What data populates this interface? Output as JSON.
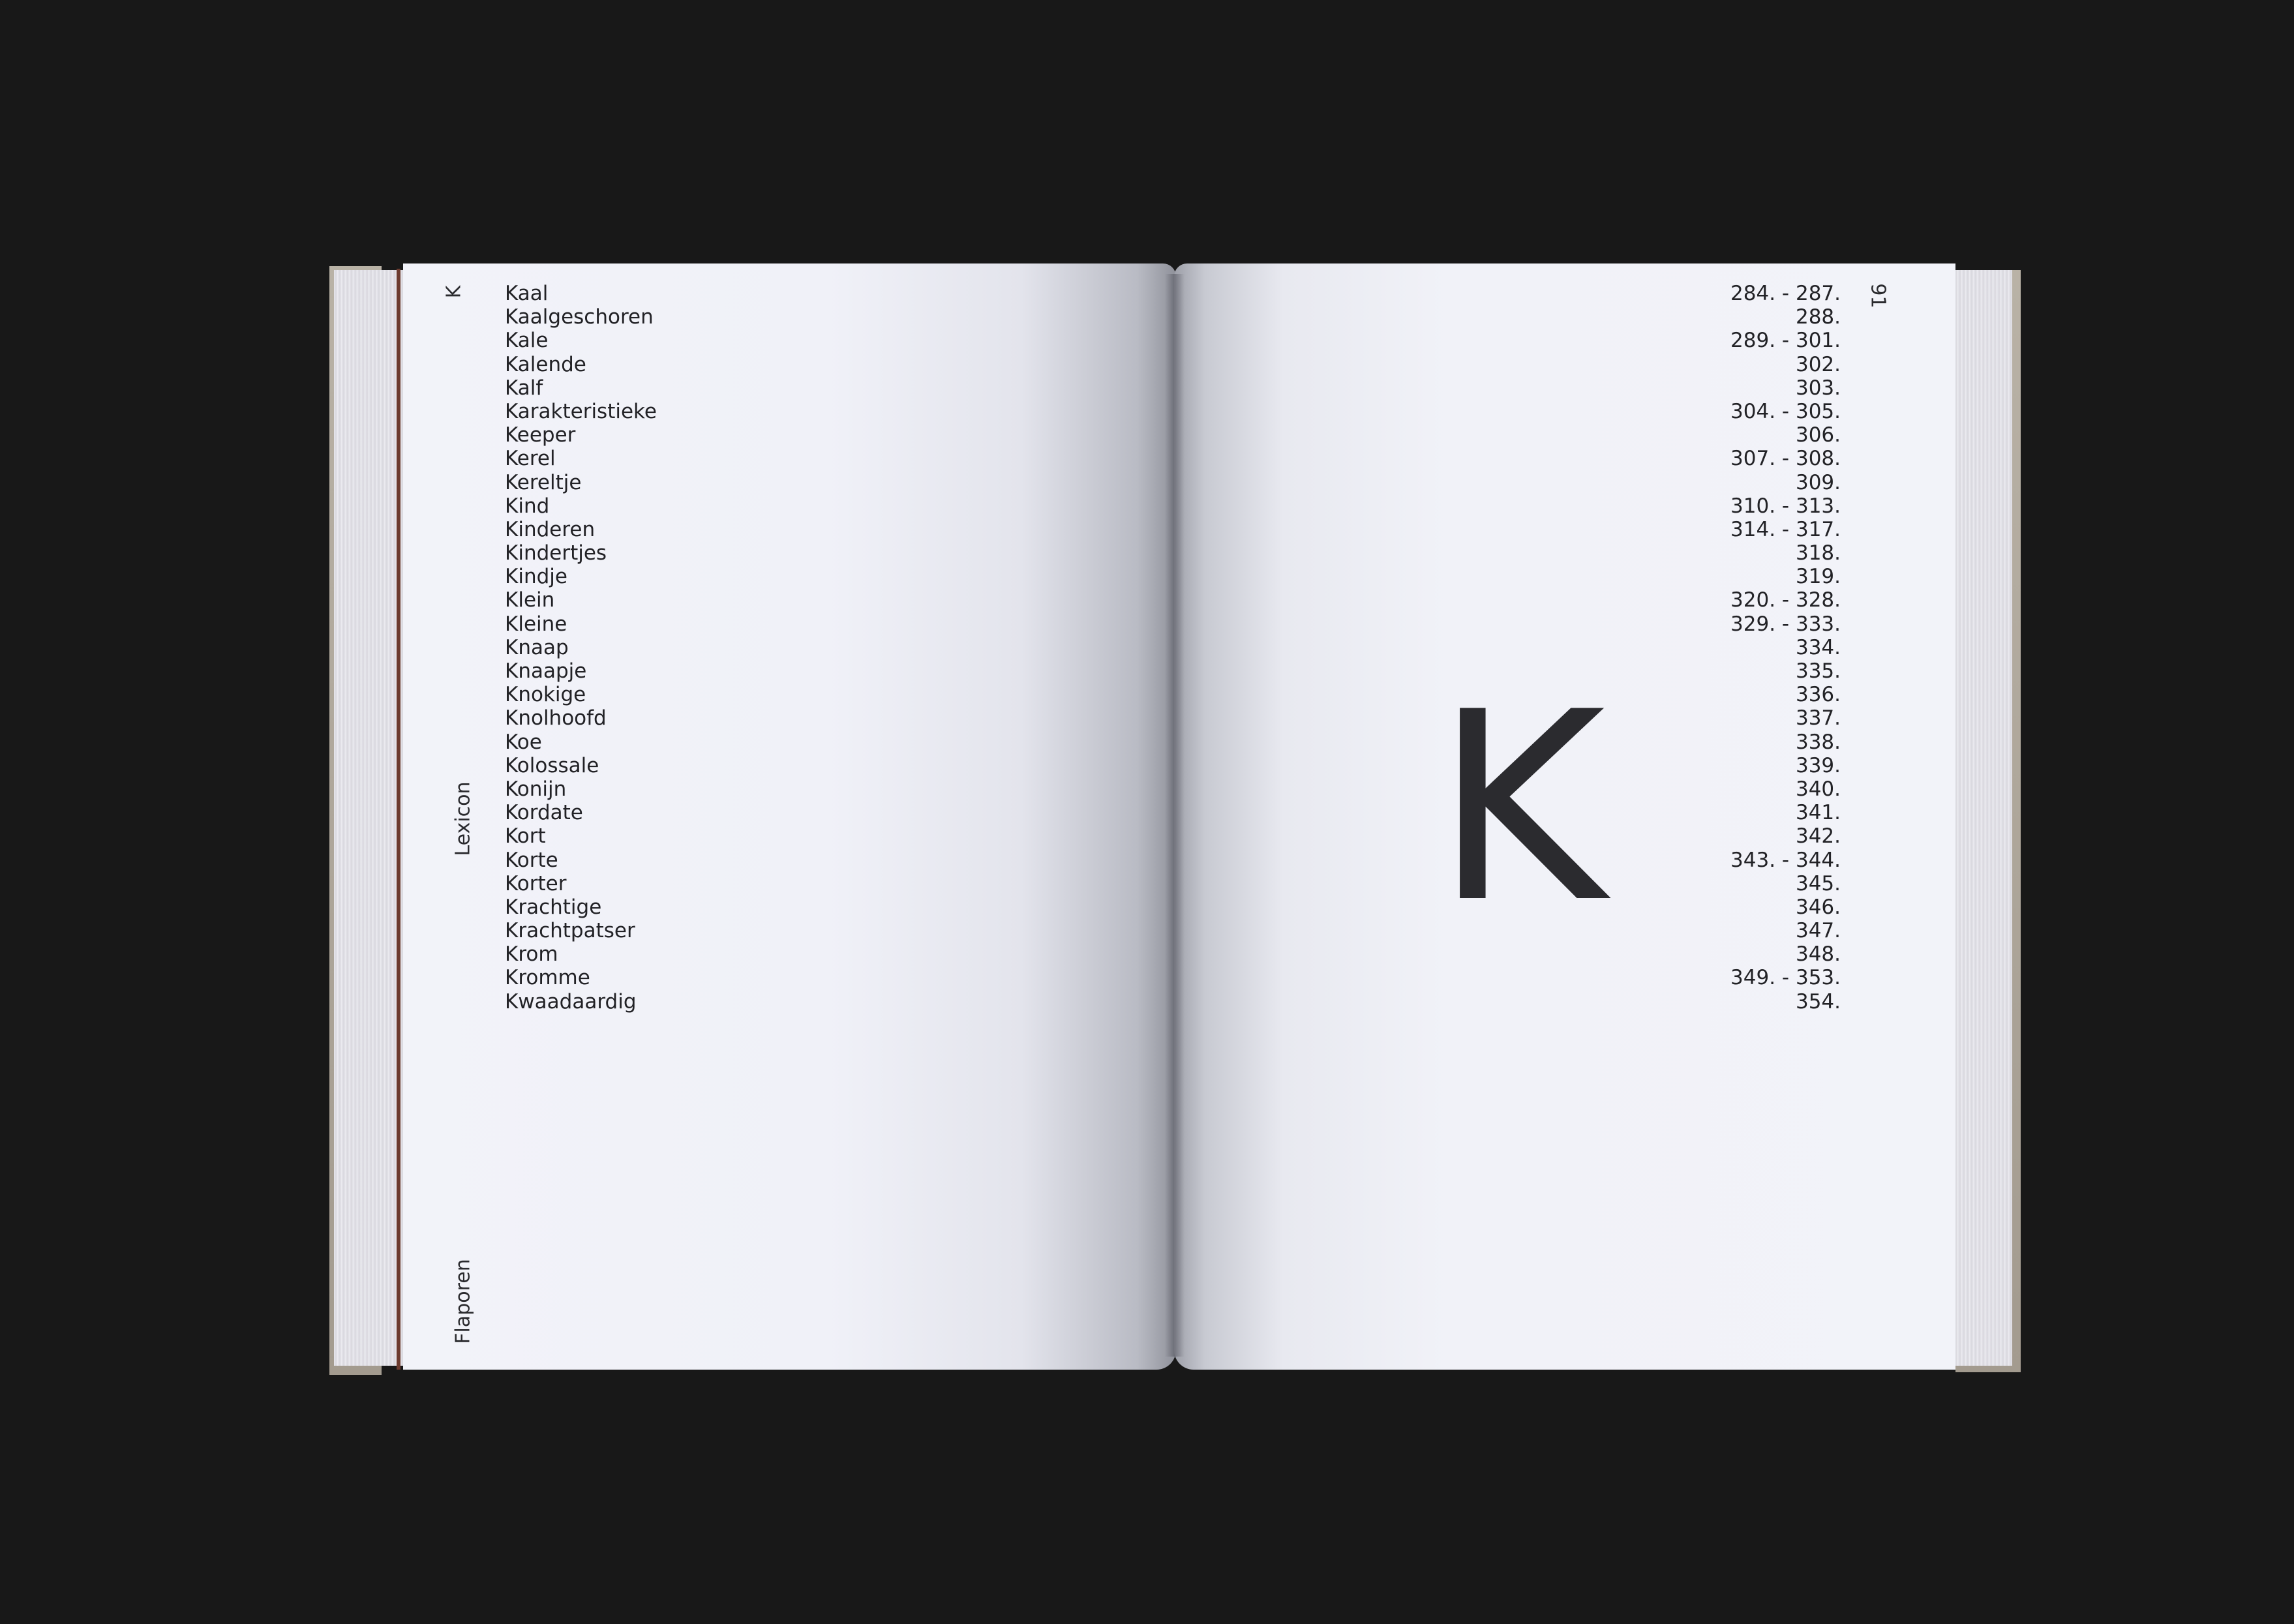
{
  "spread": {
    "left_page": {
      "running_letter": "K",
      "section_title": "Lexicon",
      "book_title": "Flaporen",
      "entries": [
        "Kaal",
        "Kaalgeschoren",
        "Kale",
        "Kalende",
        "Kalf",
        "Karakteristieke",
        "Keeper",
        "Kerel",
        "Kereltje",
        "Kind",
        "Kinderen",
        "Kindertjes",
        "Kindje",
        "Klein",
        "Kleine",
        "Knaap",
        "Knaapje",
        "Knokige",
        "Knolhoofd",
        "Koe",
        "Kolossale",
        "Konijn",
        "Kordate",
        "Kort",
        "Korte",
        "Korter",
        "Krachtige",
        "Krachtpatser",
        "Krom",
        "Kromme",
        "Kwaadaardig"
      ]
    },
    "right_page": {
      "folio": "91",
      "big_letter": "K",
      "page_refs": [
        "284. - 287.",
        "288.",
        "289. - 301.",
        "302.",
        "303.",
        "304. - 305.",
        "306.",
        "307. - 308.",
        "309.",
        "310. - 313.",
        "314. - 317.",
        "318.",
        "319.",
        "320. - 328.",
        "329. - 333.",
        "334.",
        "335.",
        "336.",
        "337.",
        "338.",
        "339.",
        "340.",
        "341.",
        "342.",
        "343. - 344.",
        "345.",
        "346.",
        "347.",
        "348.",
        "349. - 353.",
        "354."
      ]
    }
  },
  "colors": {
    "background": "#181818",
    "paper": "#f2f3f9",
    "ink": "#222226",
    "ribbon": "#6c3b2f"
  }
}
